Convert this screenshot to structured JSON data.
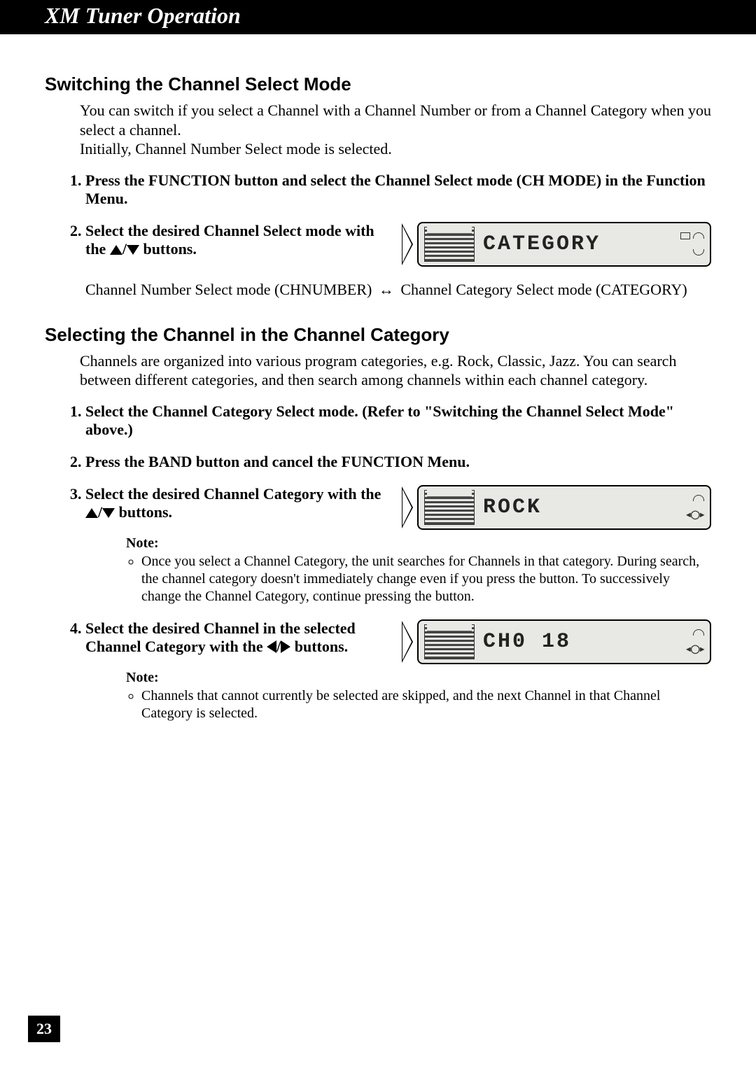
{
  "header": {
    "title": "XM Tuner Operation"
  },
  "section1": {
    "heading": "Switching the Channel Select Mode",
    "intro": "You can switch if you select a Channel with a Channel Number or from a Channel Category when you select a channel.\nInitially, Channel Number Select mode is selected.",
    "step1": "Press the FUNCTION button and select the Channel Select mode (CH MODE) in the Function Menu.",
    "step2_a": "Select the desired Channel Select mode with the ",
    "step2_b": " buttons.",
    "display1": "CATEGORY",
    "modeLine_a": "Channel Number Select mode (CHNUMBER) ",
    "modeLine_b": " Channel Category Select mode (CATEGORY)"
  },
  "section2": {
    "heading": "Selecting the Channel in the Channel Category",
    "intro": "Channels are organized into various program categories, e.g. Rock, Classic, Jazz. You can search between different categories, and then search among channels within each channel category.",
    "step1": "Select the Channel Category Select mode. (Refer to \"Switching the Channel Select Mode\" above.)",
    "step2": "Press the BAND button and cancel the FUNCTION Menu.",
    "step3_a": "Select the desired Channel Category with the ",
    "step3_b": " buttons.",
    "display2": "ROCK",
    "note1_label": "Note:",
    "note1_item": "Once you select a Channel Category, the unit searches for Channels in that category. During search, the channel category doesn't immediately change even if you press the button. To successively change the Channel Category, continue pressing the button.",
    "step4_a": "Select the desired Channel in the selected Channel Category with the ",
    "step4_b": " buttons.",
    "display3": "CH0 18",
    "note2_label": "Note:",
    "note2_item": "Channels that cannot currently be selected are skipped, and the next Channel in that Channel Category is selected."
  },
  "pageNumber": "23"
}
